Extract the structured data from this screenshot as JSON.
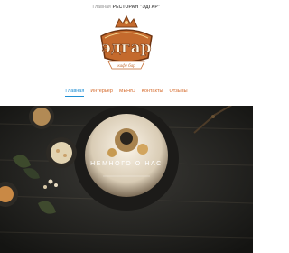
{
  "header": {
    "tagline_prefix": "Главная",
    "tagline_name": "РЕСТОРАН \"ЭДГАР\"",
    "logo": {
      "wordmark": "эдгар",
      "sub": "кафе бар",
      "brand_color": "#c46a2d"
    }
  },
  "nav": {
    "items": [
      {
        "label": "Главная",
        "active": true
      },
      {
        "label": "Интерьер"
      },
      {
        "label": "МЕНЮ"
      },
      {
        "label": "Контакты"
      },
      {
        "label": "Отзывы"
      }
    ],
    "active_color": "#1f8fd4",
    "link_color": "#d56a2b"
  },
  "hero": {
    "title": "НЕМНОГО О НАС"
  }
}
